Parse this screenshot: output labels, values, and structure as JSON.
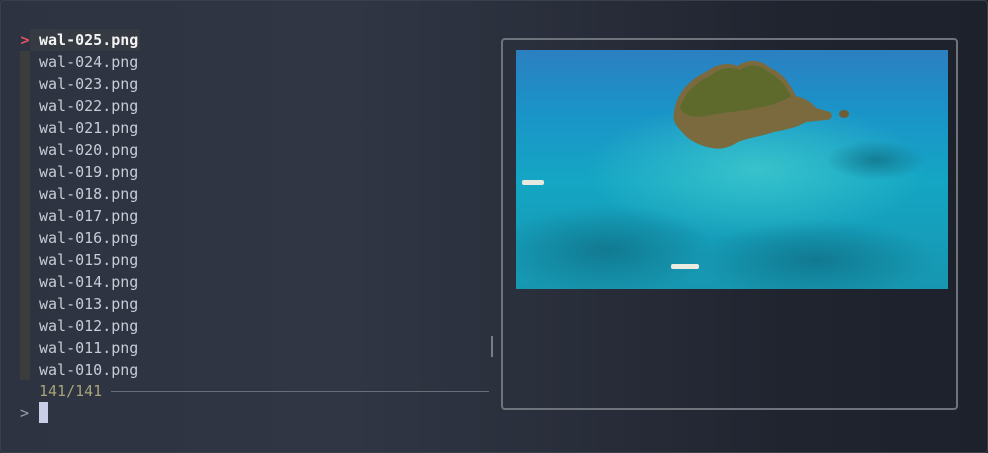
{
  "prompt": {
    "marker": ">",
    "symbol": ">",
    "query": ""
  },
  "list": {
    "selected_marker": ">",
    "items": [
      {
        "label": "wal-025.png",
        "selected": true
      },
      {
        "label": "wal-024.png",
        "selected": false
      },
      {
        "label": "wal-023.png",
        "selected": false
      },
      {
        "label": "wal-022.png",
        "selected": false
      },
      {
        "label": "wal-021.png",
        "selected": false
      },
      {
        "label": "wal-020.png",
        "selected": false
      },
      {
        "label": "wal-019.png",
        "selected": false
      },
      {
        "label": "wal-018.png",
        "selected": false
      },
      {
        "label": "wal-017.png",
        "selected": false
      },
      {
        "label": "wal-016.png",
        "selected": false
      },
      {
        "label": "wal-015.png",
        "selected": false
      },
      {
        "label": "wal-014.png",
        "selected": false
      },
      {
        "label": "wal-013.png",
        "selected": false
      },
      {
        "label": "wal-012.png",
        "selected": false
      },
      {
        "label": "wal-011.png",
        "selected": false
      },
      {
        "label": "wal-010.png",
        "selected": false
      }
    ]
  },
  "status": {
    "count": "141/141"
  },
  "preview": {
    "image_semantic": "aerial-island-reef-photo"
  },
  "colors": {
    "marker": "#e05561",
    "count": "#a7a37a",
    "selected_text": "#f3f3f3",
    "item_text": "#c8ccd6",
    "cursor": "#c9cde8",
    "border": "#6f737c"
  }
}
